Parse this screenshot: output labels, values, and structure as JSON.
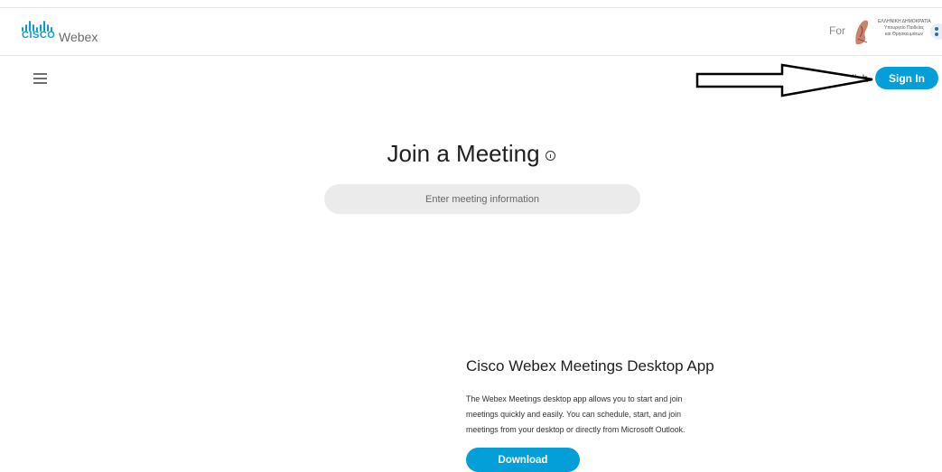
{
  "header": {
    "brand_cisco": "CISCO",
    "brand_webex": "Webex",
    "for_label": "For",
    "org_lines": [
      "ΕΛΛΗΝΙΚΗ ΔΗΜΟΚΡΑΤΙΑ",
      "Υπουργείο Παιδείας",
      "και Θρησκευμάτων"
    ]
  },
  "nav": {
    "language": "English",
    "sign_in": "Sign In"
  },
  "join": {
    "title": "Join a Meeting",
    "input_placeholder": "Enter meeting information"
  },
  "desktop_app": {
    "title": "Cisco Webex Meetings Desktop App",
    "lines": [
      "The Webex Meetings desktop app allows you to start and join",
      "meetings quickly and easily. You can schedule, start, and join",
      "meetings from your desktop or directly from Microsoft Outlook."
    ],
    "download": "Download"
  },
  "colors": {
    "accent": "#049fd9",
    "input_bg": "#ebebeb"
  }
}
